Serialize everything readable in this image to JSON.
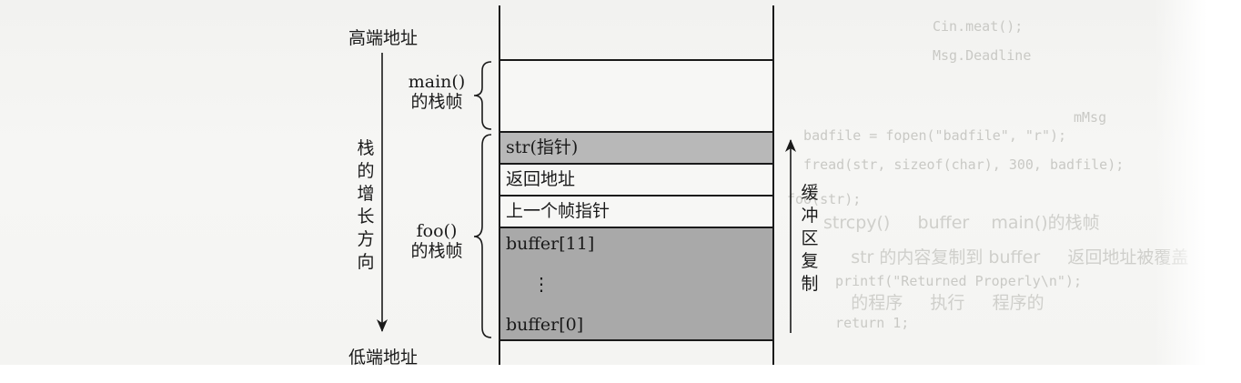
{
  "addresses": {
    "high": "高端地址",
    "low": "低端地址"
  },
  "frames": {
    "main": [
      "main()",
      "的栈帧"
    ],
    "foo": [
      "foo()",
      "的栈帧"
    ]
  },
  "stack_cells": [
    {
      "label": "str(指针)",
      "fill": "#b8b8b8"
    },
    {
      "label": "返回地址",
      "fill": "#f7f7f5"
    },
    {
      "label": "上一个帧指针",
      "fill": "#f7f7f5"
    }
  ],
  "buffer": {
    "top_label": "buffer[11]",
    "ellipsis": "⋮",
    "bottom_label": "buffer[0]",
    "fill": "#a9a9a9"
  },
  "growth_direction_chars": [
    "栈",
    "的",
    "增",
    "长",
    "方",
    "向"
  ],
  "copy_direction_chars": [
    "缓",
    "冲",
    "区",
    "复",
    "制"
  ],
  "colors": {
    "line": "#1a1a1a",
    "pointer_cell": "#b8b8b8",
    "buffer_cell": "#a9a9a9"
  }
}
